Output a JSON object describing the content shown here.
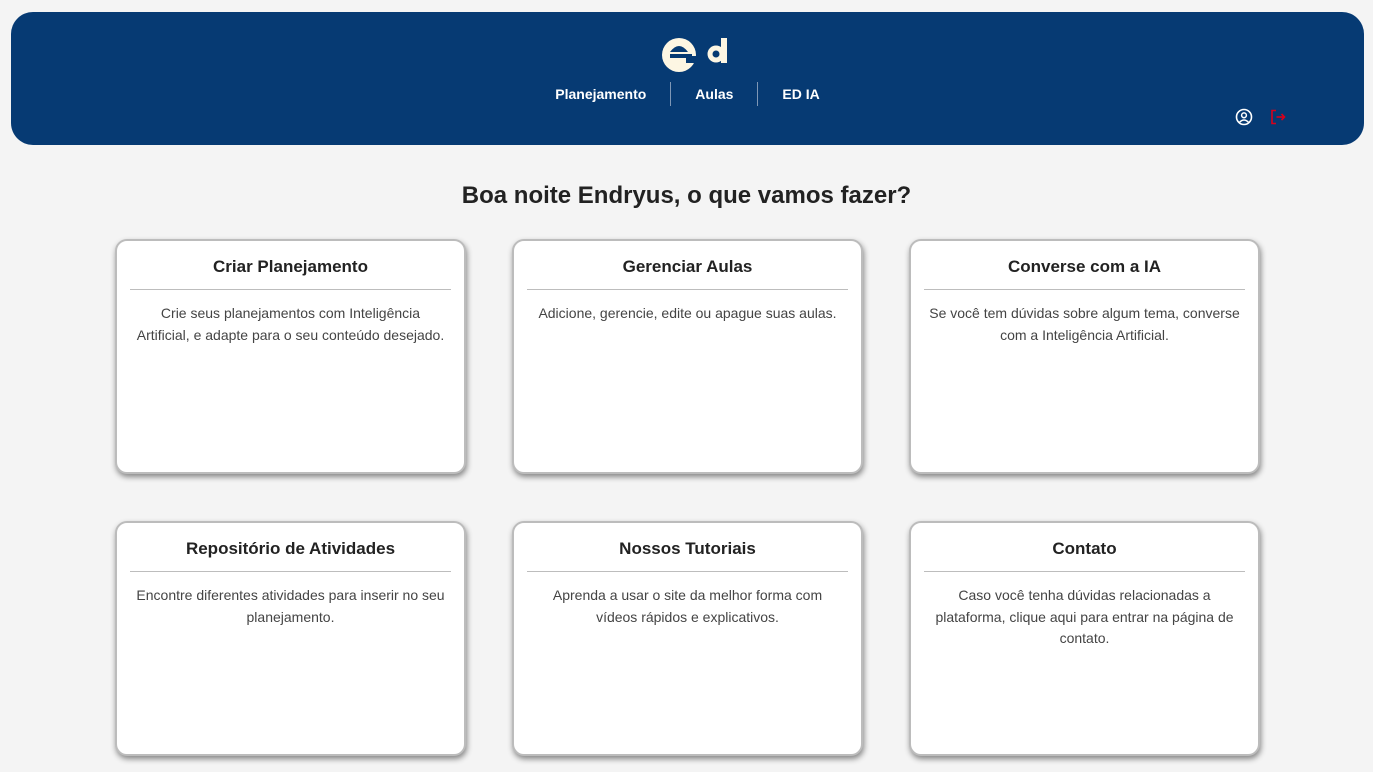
{
  "header": {
    "logo_icon": "ed-logo",
    "nav": [
      "Planejamento",
      "Aulas",
      "ED IA"
    ],
    "user_icon": "user-circle-icon",
    "logout_icon": "logout-icon",
    "logout_color": "#d9001b"
  },
  "greeting": "Boa noite Endryus, o que vamos fazer?",
  "cards": [
    {
      "title": "Criar Planejamento",
      "text": "Crie seus planejamentos com Inteligência Artificial, e adapte para o seu conteúdo desejado."
    },
    {
      "title": "Gerenciar Aulas",
      "text": "Adicione, gerencie, edite ou apague suas aulas."
    },
    {
      "title": "Converse com a IA",
      "text": "Se você tem dúvidas sobre algum tema, converse com a Inteligência Artificial."
    },
    {
      "title": "Repositório de Atividades",
      "text": "Encontre diferentes atividades para inserir no seu planejamento."
    },
    {
      "title": "Nossos Tutoriais",
      "text": "Aprenda a usar o site da melhor forma com vídeos rápidos e explicativos."
    },
    {
      "title": "Contato",
      "text": "Caso você tenha dúvidas relacionadas a plataforma, clique aqui para entrar na página de contato."
    }
  ],
  "colors": {
    "header_bg": "#063a73",
    "page_bg": "#f4f4f4",
    "logo": "#fdf6e3"
  }
}
